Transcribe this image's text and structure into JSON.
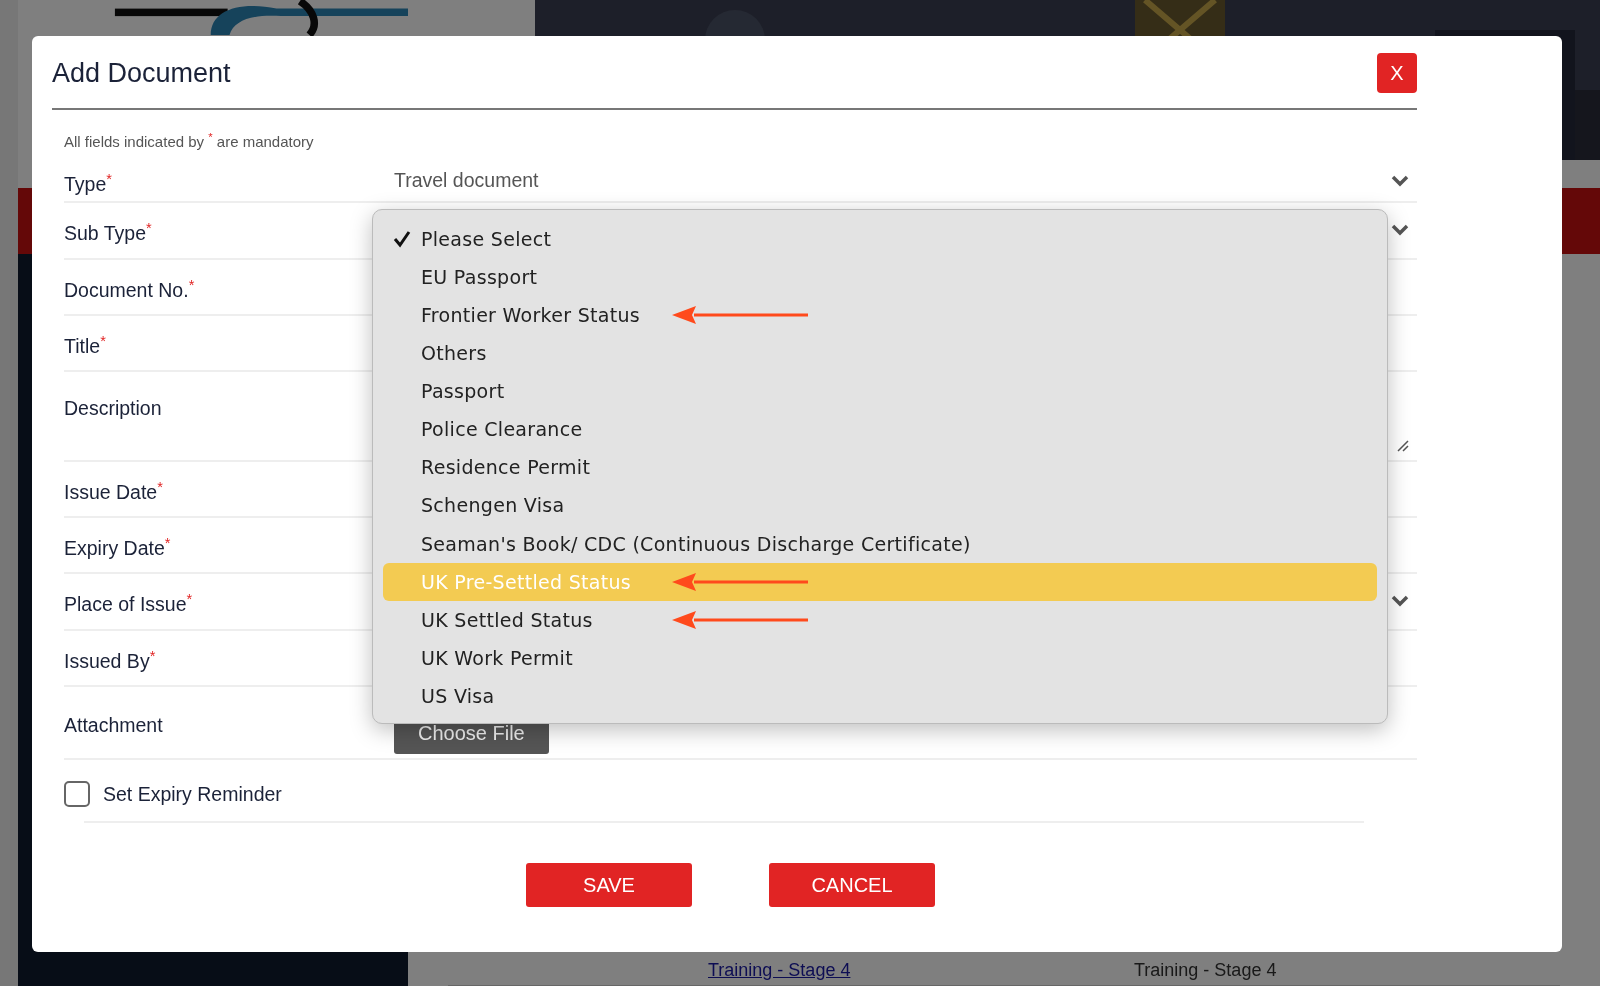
{
  "background": {
    "table_row": [
      {
        "text": "Training - Stage 4",
        "kind": "link"
      },
      {
        "text": "Training - Stage 4",
        "kind": "text"
      }
    ]
  },
  "dialog": {
    "title": "Add Document",
    "close_label": "X",
    "mandatory_note": "All fields indicated by $^{*}$ are mandatory",
    "fields": [
      {
        "label": "Type",
        "mark": "*",
        "kind": "select",
        "value": "Travel document"
      },
      {
        "label": "Sub Type",
        "mark": "*",
        "kind": "select"
      },
      {
        "label": "Document No.",
        "mark": "*",
        "kind": "text"
      },
      {
        "label": "Title",
        "mark": "*",
        "kind": "text"
      },
      {
        "label": "Description",
        "kind": "textarea"
      },
      {
        "label": "Issue Date",
        "mark": "*",
        "kind": "text"
      },
      {
        "label": "Expiry Date",
        "mark": "*",
        "kind": "text"
      },
      {
        "label": "Place of Issue",
        "mark": "*",
        "kind": "select"
      },
      {
        "label": "Issued By",
        "mark": "*",
        "kind": "text"
      },
      {
        "label": "Attachment",
        "kind": "file",
        "button": "Choose File"
      }
    ],
    "reminder": {
      "label": "Set Expiry Reminder",
      "checked": false
    },
    "buttons": [
      "SAVE",
      "CANCEL"
    ],
    "dropdown": {
      "options": [
        {
          "label": "Please Select",
          "selected": true,
          "highlighted": false,
          "arrow": false
        },
        {
          "label": "EU Passport",
          "selected": false,
          "highlighted": false,
          "arrow": false
        },
        {
          "label": "Frontier Worker Status",
          "selected": false,
          "highlighted": false,
          "arrow": true
        },
        {
          "label": "Others",
          "selected": false,
          "highlighted": false,
          "arrow": false
        },
        {
          "label": "Passport",
          "selected": false,
          "highlighted": false,
          "arrow": false
        },
        {
          "label": "Police Clearance",
          "selected": false,
          "highlighted": false,
          "arrow": false
        },
        {
          "label": "Residence Permit",
          "selected": false,
          "highlighted": false,
          "arrow": false
        },
        {
          "label": "Schengen Visa",
          "selected": false,
          "highlighted": false,
          "arrow": false
        },
        {
          "label": "Seaman's Book/ CDC (Continuous Discharge Certificate)",
          "selected": false,
          "highlighted": false,
          "arrow": false
        },
        {
          "label": "UK Pre-Settled Status",
          "selected": false,
          "highlighted": true,
          "arrow": true
        },
        {
          "label": "UK Settled Status",
          "selected": false,
          "highlighted": false,
          "arrow": true
        },
        {
          "label": "UK Work Permit",
          "selected": false,
          "highlighted": false,
          "arrow": false
        },
        {
          "label": "US Visa",
          "selected": false,
          "highlighted": false,
          "arrow": false
        }
      ]
    }
  }
}
